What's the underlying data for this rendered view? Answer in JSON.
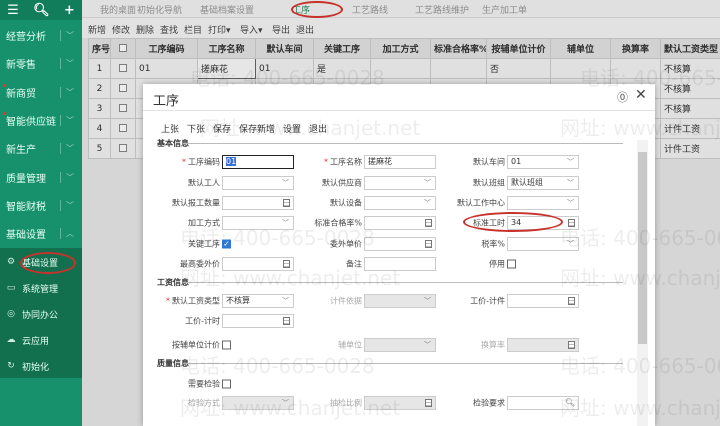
{
  "sidebar": {
    "top_icons": [
      "menu-icon",
      "search-icon",
      "plus-icon"
    ],
    "items": [
      {
        "label": "经营分析",
        "dot": false
      },
      {
        "label": "新零售",
        "dot": false
      },
      {
        "label": "新商贸",
        "dot": true
      },
      {
        "label": "智能供应链",
        "dot": true
      },
      {
        "label": "新生产",
        "dot": false
      },
      {
        "label": "质量管理",
        "dot": false
      },
      {
        "label": "智能财税",
        "dot": false
      },
      {
        "label": "基础设置",
        "dot": false,
        "expanded": true
      }
    ],
    "sub_items": [
      {
        "label": "基础设置",
        "icon": "gear-icon",
        "glyph": "⚙"
      },
      {
        "label": "系统管理",
        "icon": "monitor-icon",
        "glyph": "▭"
      },
      {
        "label": "协同办公",
        "icon": "target-icon",
        "glyph": "◎"
      },
      {
        "label": "云应用",
        "icon": "cloud-icon",
        "glyph": "☁"
      },
      {
        "label": "初始化",
        "icon": "refresh-icon",
        "glyph": "↻"
      }
    ]
  },
  "tabs": [
    {
      "label": "我的桌面"
    },
    {
      "label": "初始化导航"
    },
    {
      "label": "基础档案设置"
    },
    {
      "label": "工序",
      "active": true
    },
    {
      "label": "工艺路线"
    },
    {
      "label": "工艺路线维护"
    },
    {
      "label": "生产加工单"
    }
  ],
  "toolbar": [
    "新增",
    "修改",
    "删除",
    "查找",
    "栏目",
    "打印▾",
    "导入▾",
    "导出",
    "退出"
  ],
  "table": {
    "headers": [
      "序号",
      "",
      "工序编码",
      "工序名称",
      "默认车间",
      "关键工序",
      "加工方式",
      "标准合格率%",
      "按辅单位计价",
      "辅单位",
      "换算率",
      "默认工资类型"
    ],
    "rows": [
      [
        "1",
        "",
        "01",
        "搓麻花",
        "01",
        "是",
        "",
        "",
        "否",
        "",
        "",
        "不核算"
      ],
      [
        "2",
        "",
        "",
        "",
        "",
        "",
        "",
        "",
        "",
        "",
        "",
        "不核算"
      ],
      [
        "3",
        "",
        "",
        "",
        "",
        "",
        "",
        "",
        "",
        "",
        "",
        "不核算"
      ],
      [
        "4",
        "",
        "",
        "",
        "",
        "",
        "",
        "",
        "",
        "",
        "",
        "计件工资"
      ],
      [
        "5",
        "",
        "",
        "",
        "",
        "",
        "",
        "",
        "",
        "",
        "",
        "计件工资"
      ]
    ]
  },
  "dialog": {
    "title": "工序",
    "toolbar": [
      "上张",
      "下张",
      "保存",
      "保存新增",
      "设置",
      "退出"
    ],
    "sections": [
      {
        "title": "基本信息",
        "fields": [
          {
            "label": "工序编码",
            "type": "text",
            "value": "01",
            "required": true,
            "selected": true,
            "focus": true
          },
          {
            "label": "工序名称",
            "type": "text",
            "value": "搓麻花",
            "required": true
          },
          {
            "label": "默认车间",
            "type": "select",
            "value": "01"
          },
          {
            "label": "默认工人",
            "type": "select",
            "value": ""
          },
          {
            "label": "默认供应商",
            "type": "select",
            "value": ""
          },
          {
            "label": "默认班组",
            "type": "select",
            "value": "默认班组"
          },
          {
            "label": "默认报工数量",
            "type": "calc",
            "value": ""
          },
          {
            "label": "默认设备",
            "type": "select",
            "value": ""
          },
          {
            "label": "默认工作中心",
            "type": "select",
            "value": ""
          },
          {
            "label": "加工方式",
            "type": "select",
            "value": ""
          },
          {
            "label": "标准合格率%",
            "type": "calc",
            "value": ""
          },
          {
            "label": "标准工时",
            "type": "calc",
            "value": "34",
            "highlight": true
          },
          {
            "label": "关键工序",
            "type": "checkbox",
            "checked": true
          },
          {
            "label": "委外单价",
            "type": "calc",
            "value": ""
          },
          {
            "label": "税率%",
            "type": "select",
            "value": ""
          },
          {
            "label": "最高委外价",
            "type": "calc",
            "value": ""
          },
          {
            "label": "备注",
            "type": "text",
            "value": ""
          },
          {
            "label": "停用",
            "type": "checkbox",
            "checked": false
          }
        ]
      },
      {
        "title": "工资信息",
        "fields": [
          {
            "label": "默认工资类型",
            "type": "select",
            "value": "不核算",
            "required": true
          },
          {
            "label": "计件依据",
            "type": "select",
            "value": "",
            "disabled": true
          },
          {
            "label": "工价-计件",
            "type": "calc",
            "value": ""
          },
          {
            "label": "工价-计时",
            "type": "calc",
            "value": ""
          },
          null,
          null,
          {
            "label": "按辅单位计价",
            "type": "checkbox",
            "checked": false
          },
          {
            "label": "辅单位",
            "type": "select",
            "value": "",
            "disabled": true
          },
          {
            "label": "换算率",
            "type": "calc",
            "value": "",
            "disabled": true
          }
        ]
      },
      {
        "title": "质量信息",
        "fields": [
          {
            "label": "需要检验",
            "type": "checkbox",
            "checked": false
          },
          null,
          null,
          {
            "label": "检验方式",
            "type": "select",
            "value": "",
            "disabled": true
          },
          {
            "label": "抽检比例",
            "type": "calc",
            "value": "",
            "disabled": true
          },
          {
            "label": "检验要求",
            "type": "search",
            "value": ""
          }
        ]
      }
    ]
  },
  "watermark": {
    "phone": "电话: 400-665-0028",
    "site": "网址: www.chanjet.net"
  },
  "colors": {
    "sidebar": "#17916b",
    "annotation": "#c8322c",
    "checkbox": "#2f78d3"
  }
}
